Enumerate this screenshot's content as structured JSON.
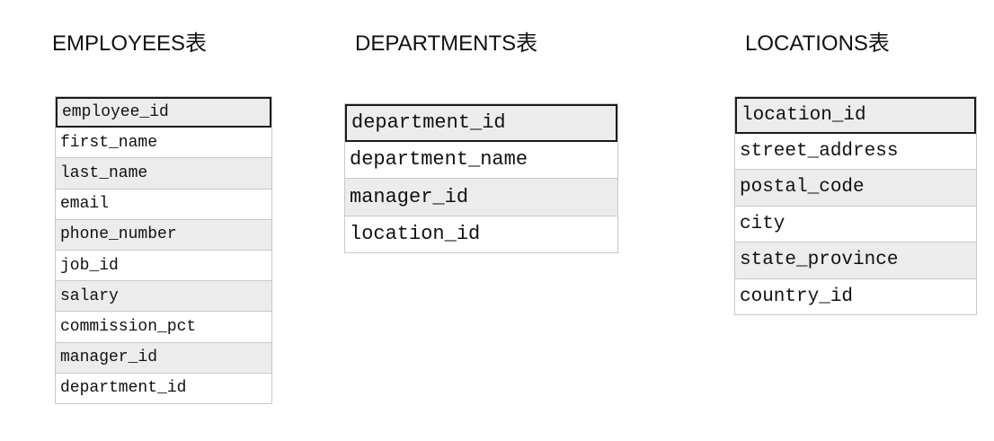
{
  "tables": [
    {
      "id": "employees",
      "title": "EMPLOYEES表",
      "fields": [
        "employee_id",
        "first_name",
        "last_name",
        "email",
        "phone_number",
        "job_id",
        "salary",
        "commission_pct",
        "manager_id",
        "department_id"
      ],
      "primary_key_index": 0
    },
    {
      "id": "departments",
      "title": "DEPARTMENTS表",
      "fields": [
        "department_id",
        "department_name",
        "manager_id",
        "location_id"
      ],
      "primary_key_index": 0
    },
    {
      "id": "locations",
      "title": "LOCATIONS表",
      "fields": [
        "location_id",
        "street_address",
        "postal_code",
        "city",
        "state_province",
        "country_id"
      ],
      "primary_key_index": 0
    }
  ],
  "colors": {
    "row_alt": "#ececec",
    "row_plain": "#ffffff",
    "border": "#c8c8c8",
    "pk_border": "#1a1a1a"
  }
}
